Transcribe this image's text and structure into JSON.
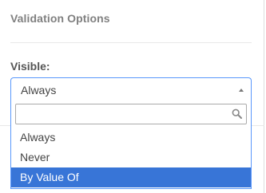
{
  "section": {
    "title": "Validation Options"
  },
  "visible_field": {
    "label": "Visible:",
    "selected": "Always",
    "search": {
      "value": "",
      "placeholder": ""
    },
    "options": [
      {
        "label": "Always",
        "highlighted": false
      },
      {
        "label": "Never",
        "highlighted": false
      },
      {
        "label": "By Value Of",
        "highlighted": true
      }
    ]
  },
  "colors": {
    "focus_border": "#5897fb",
    "highlight": "#3875d7",
    "section_title": "#808080"
  },
  "icons": {
    "caret": "caret-up-icon",
    "search": "search-icon"
  }
}
